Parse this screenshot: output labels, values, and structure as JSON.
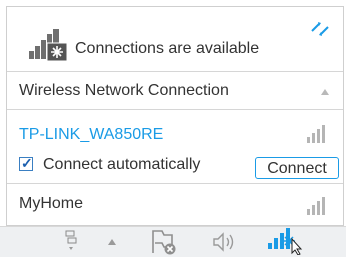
{
  "header": {
    "status_text": "Connections are available",
    "status_icon": "network-computer-icon",
    "refresh_icon": "refresh-arrows-icon"
  },
  "section": {
    "label": "Wireless Network Connection",
    "collapse_icon": "chevron-up-icon"
  },
  "networks": [
    {
      "name": "TP-LINK_WA850RE",
      "selected": true,
      "connect_automatically_label": "Connect automatically",
      "connect_automatically_checked": true,
      "connect_button_label": "Connect",
      "signal_icon": "signal-bars-icon"
    },
    {
      "name": "MyHome",
      "selected": false,
      "signal_icon": "signal-bars-icon"
    }
  ],
  "taskbar": {
    "icons": [
      "network-tray-icon",
      "show-hidden-icons-icon",
      "flag-icon",
      "speaker-icon",
      "wireless-tray-icon"
    ]
  },
  "colors": {
    "accent": "#1a9be6",
    "taskbar": "#eef0f2"
  }
}
